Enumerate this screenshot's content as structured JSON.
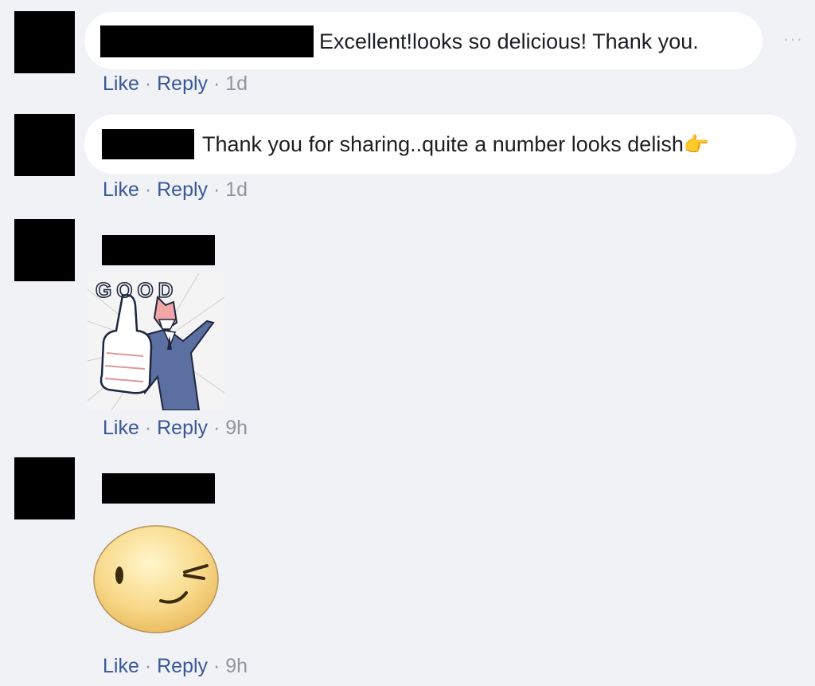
{
  "comments": [
    {
      "text": "Excellent!looks so delicious! Thank you.",
      "actions": {
        "like": "Like",
        "reply": "Reply",
        "time": "1d"
      }
    },
    {
      "text": "Thank you for sharing..quite a number looks delish",
      "emoji": "👉",
      "actions": {
        "like": "Like",
        "reply": "Reply",
        "time": "1d"
      }
    },
    {
      "sticker": {
        "text": "GOOD",
        "icon": "thumbs-up-businessman-sticker"
      },
      "actions": {
        "like": "Like",
        "reply": "Reply",
        "time": "9h"
      }
    },
    {
      "sticker": {
        "icon": "winking-face-sticker"
      },
      "actions": {
        "like": "Like",
        "reply": "Reply",
        "time": "9h"
      }
    }
  ],
  "more_label": "···",
  "separator": "·"
}
